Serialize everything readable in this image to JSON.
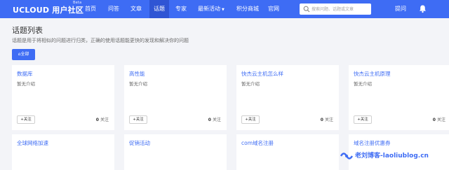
{
  "brand": {
    "logo": "UCLOUD 用户社区",
    "badge": "Beta"
  },
  "nav": {
    "items": [
      "首页",
      "问答",
      "文章",
      "话题",
      "专家",
      "最新活动",
      "积分商城",
      "官网"
    ],
    "active": "话题"
  },
  "search": {
    "placeholder": "搜索问题、话题或文章"
  },
  "header_actions": {
    "ask": "提问"
  },
  "page": {
    "title": "话题列表",
    "description": "话题是用于将相似的问题进行归类，正确的使用话题能更快的发现和解决你的问题",
    "all_button": "全部"
  },
  "topics": [
    {
      "name": "数据库",
      "desc": "暂无介绍",
      "follow": "关注",
      "count": "0",
      "count_label": "关注"
    },
    {
      "name": "高性能",
      "desc": "暂无介绍",
      "follow": "关注",
      "count": "0",
      "count_label": "关注"
    },
    {
      "name": "快杰云主机怎么样",
      "desc": "暂无介绍",
      "follow": "关注",
      "count": "0",
      "count_label": "关注"
    },
    {
      "name": "快杰云主机原理",
      "desc": "暂无介绍",
      "follow": "关注",
      "count": "0",
      "count_label": "关注"
    },
    {
      "name": "全球网络加速",
      "desc": ""
    },
    {
      "name": "促销活动",
      "desc": ""
    },
    {
      "name": "com域名注册",
      "desc": ""
    },
    {
      "name": "域名注册优惠券",
      "desc": ""
    }
  ],
  "watermark": {
    "text": "老刘博客-laoliublog.cn"
  },
  "colors": {
    "primary": "#3e6cf4",
    "active_nav": "#2f55d4",
    "background": "#f3f4f8"
  }
}
